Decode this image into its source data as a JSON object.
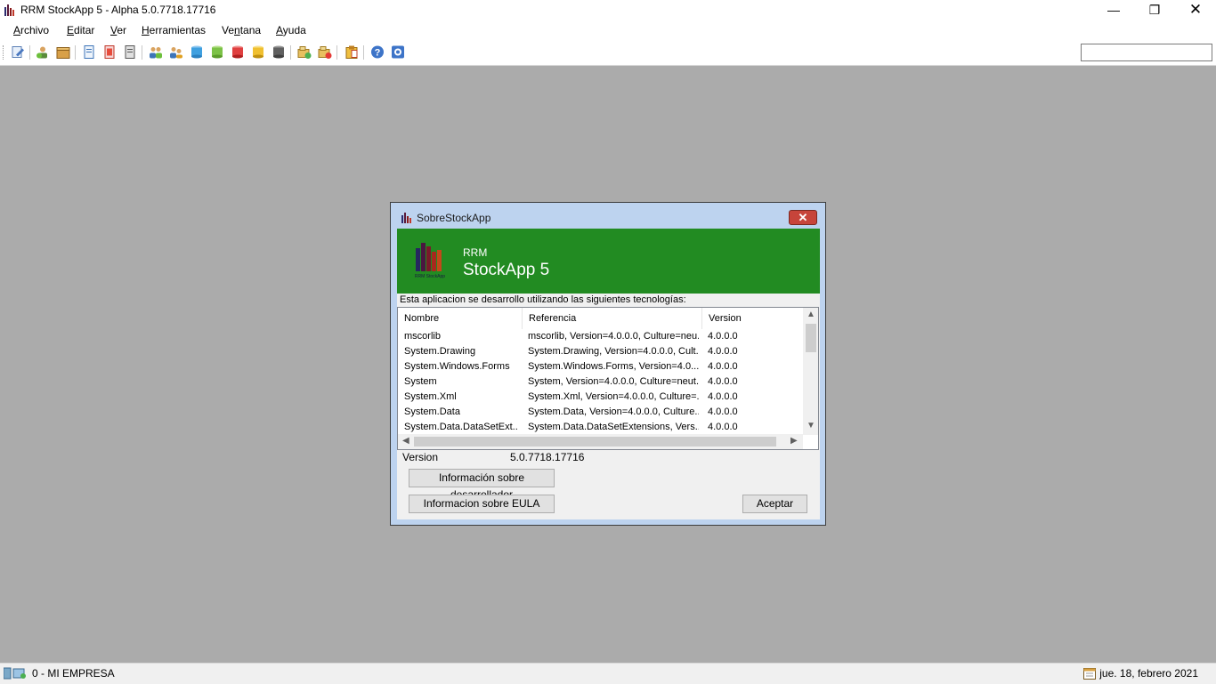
{
  "window": {
    "title": "RRM StockApp 5 - Alpha 5.0.7718.17716",
    "min_glyph": "—",
    "max_glyph": "❐",
    "close_glyph": "✕"
  },
  "menu": [
    {
      "label": "Archivo",
      "mnemonic": "A",
      "rest": "rchivo"
    },
    {
      "label": "Editar",
      "mnemonic": "E",
      "rest": "ditar"
    },
    {
      "label": "Ver",
      "mnemonic": "V",
      "rest": "er"
    },
    {
      "label": "Herramientas",
      "mnemonic": "H",
      "rest": "erramientas"
    },
    {
      "label": "Ventana",
      "mnemonic": "n",
      "pre": "Ve",
      "rest": "tana"
    },
    {
      "label": "Ayuda",
      "mnemonic": "A",
      "rest": "yuda"
    }
  ],
  "toolbar": {
    "icons": [
      "edit-doc-icon",
      "add-user-icon",
      "box-icon",
      "document-blue-icon",
      "document-red-icon",
      "document-gray-icon",
      "users-group-icon",
      "users-move-icon",
      "database-blue-icon",
      "database-green-icon",
      "database-red-icon",
      "database-yellow-icon",
      "database-gray-icon",
      "add-folder-icon",
      "remove-folder-icon",
      "clipboard-icon",
      "help-icon",
      "about-icon"
    ],
    "search_value": ""
  },
  "dialog": {
    "title": "SobreStockApp",
    "banner_small": "RRM",
    "banner_title": "StockApp 5",
    "logo_caption": "RRM StockApp",
    "tech_label": "Esta aplicacion se desarrollo utilizando las siguientes tecnologías:",
    "columns": [
      "Nombre",
      "Referencia",
      "Version"
    ],
    "rows": [
      [
        "mscorlib",
        "mscorlib, Version=4.0.0.0, Culture=neu...",
        "4.0.0.0"
      ],
      [
        "System.Drawing",
        "System.Drawing, Version=4.0.0.0, Cult...",
        "4.0.0.0"
      ],
      [
        "System.Windows.Forms",
        "System.Windows.Forms, Version=4.0....",
        "4.0.0.0"
      ],
      [
        "System",
        "System, Version=4.0.0.0, Culture=neut...",
        "4.0.0.0"
      ],
      [
        "System.Xml",
        "System.Xml, Version=4.0.0.0, Culture=...",
        "4.0.0.0"
      ],
      [
        "System.Data",
        "System.Data, Version=4.0.0.0, Culture...",
        "4.0.0.0"
      ],
      [
        "System.Data.DataSetExt...",
        "System.Data.DataSetExtensions, Vers...",
        "4.0.0.0"
      ]
    ],
    "version_label": "Version",
    "version_value": "5.0.7718.17716",
    "dev_info_button": "Información sobre desarrollador",
    "eula_button": "Informacion sobre EULA",
    "accept_button": "Aceptar",
    "close_glyph": "✕"
  },
  "status": {
    "company": "0 - MI EMPRESA",
    "date": "jue. 18, febrero 2021"
  },
  "colors": {
    "banner": "#228b22",
    "mdi_background": "#ababab"
  }
}
